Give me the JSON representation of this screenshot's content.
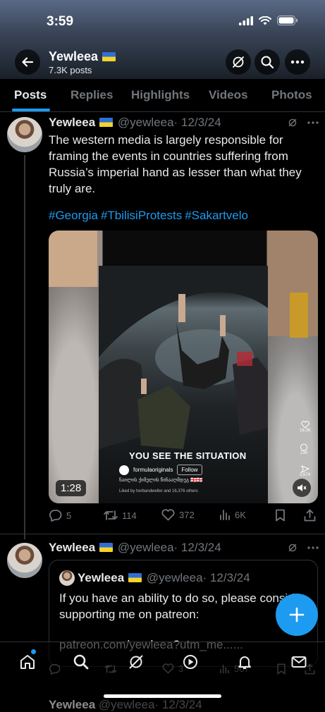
{
  "status_bar": {
    "time": "3:59"
  },
  "header": {
    "name": "Yewleea",
    "post_count": "7.3K posts"
  },
  "tabs": [
    "Posts",
    "Replies",
    "Highlights",
    "Videos",
    "Photos"
  ],
  "tweet1": {
    "name": "Yewleea",
    "handle": "@yewleea",
    "date": "· 12/3/24",
    "text": "The western media is largely responsible for framing the events in countries suffering from Russia’s imperial hand as lesser than what they truly are.",
    "hashtags": [
      "#Georgia",
      "#TbilisiProtests",
      "#Sakartvelo"
    ],
    "media": {
      "caption": "YOU SEE THE SITUATION",
      "account": "formulaoriginals",
      "follow": "Follow",
      "georgian": "ნაილის ქიმელის წინააღმდეგ 🇬🇪🇬🇪",
      "liked": "Liked by herbandweller and 16,376 others",
      "likes": "16.3K",
      "comments": "239",
      "shares": "3,674",
      "duration": "1:28"
    },
    "actions": {
      "replies": "5",
      "reposts": "114",
      "likes": "372",
      "views": "6K"
    }
  },
  "tweet2": {
    "name": "Yewleea",
    "handle": "@yewleea",
    "date": "· 12/3/24",
    "quote": {
      "name": "Yewleea",
      "handle": "@yewleea",
      "date": "· 12/3/24",
      "text": "If you have an ability to do so, please consider supporting me on patreon:",
      "link": "patreon.com/yewleea?utm_me......"
    },
    "actions": {
      "likes": "3",
      "views": "567"
    }
  },
  "peek": {
    "name": "Yewleea",
    "handle": "@yewleea",
    "date": "· 12/3/24"
  },
  "colors": {
    "accent": "#1d9bf0",
    "background": "#000000",
    "muted": "#71767b"
  },
  "icons": [
    "back-arrow-icon",
    "grok-icon",
    "search-icon",
    "more-icon",
    "reply-icon",
    "repost-icon",
    "like-icon",
    "views-icon",
    "bookmark-icon",
    "share-icon",
    "home-icon",
    "communities-icon",
    "spaces-icon",
    "notifications-icon",
    "messages-icon",
    "plus-icon"
  ]
}
